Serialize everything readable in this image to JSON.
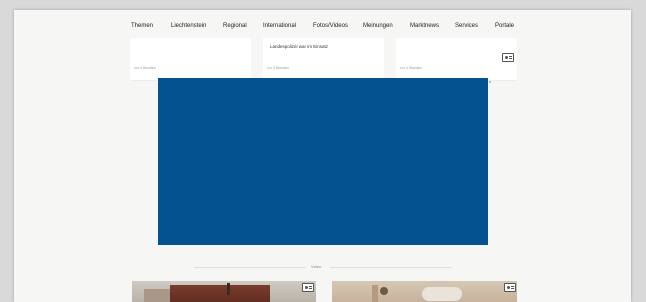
{
  "nav": {
    "items": [
      "Themen",
      "Liechtenstein",
      "Regional",
      "International",
      "Fotos/Videos",
      "Meinungen",
      "Marktnews",
      "Services",
      "Portale"
    ]
  },
  "cards": [
    {
      "title": "",
      "time": "vor 4 Stunden",
      "icon": "media-card-icon"
    },
    {
      "title": "Landespolizei war im Einsatz",
      "time": "vor 4 Stunden",
      "icon": "media-card-icon"
    },
    {
      "title": "",
      "time": "vor 4 Stunden",
      "icon": "media-card-icon"
    }
  ],
  "ad": {
    "color": "#04528f"
  },
  "section": {
    "label": "Video"
  },
  "thumbnails": [
    {
      "icon": "media-card-icon"
    },
    {
      "icon": "media-card-icon"
    }
  ]
}
